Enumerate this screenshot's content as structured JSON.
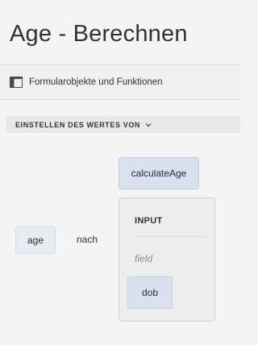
{
  "header": {
    "title": "Age - Berechnen"
  },
  "toolbar": {
    "form_objects_label": "Formularobjekte und Funktionen",
    "icon": "panel-toggle-icon"
  },
  "rule": {
    "section_label": "EINSTELLEN DES WERTES VON",
    "section_icon": "chevron-down-icon",
    "target_field": "age",
    "connector": "nach",
    "function_name": "calculateAge",
    "input_heading": "INPUT",
    "input_param_label": "field",
    "input_value": "dob"
  },
  "colors": {
    "background": "#f4f4f4",
    "chip_fill": "#d9e1ee",
    "panel_fill": "#ededed"
  }
}
